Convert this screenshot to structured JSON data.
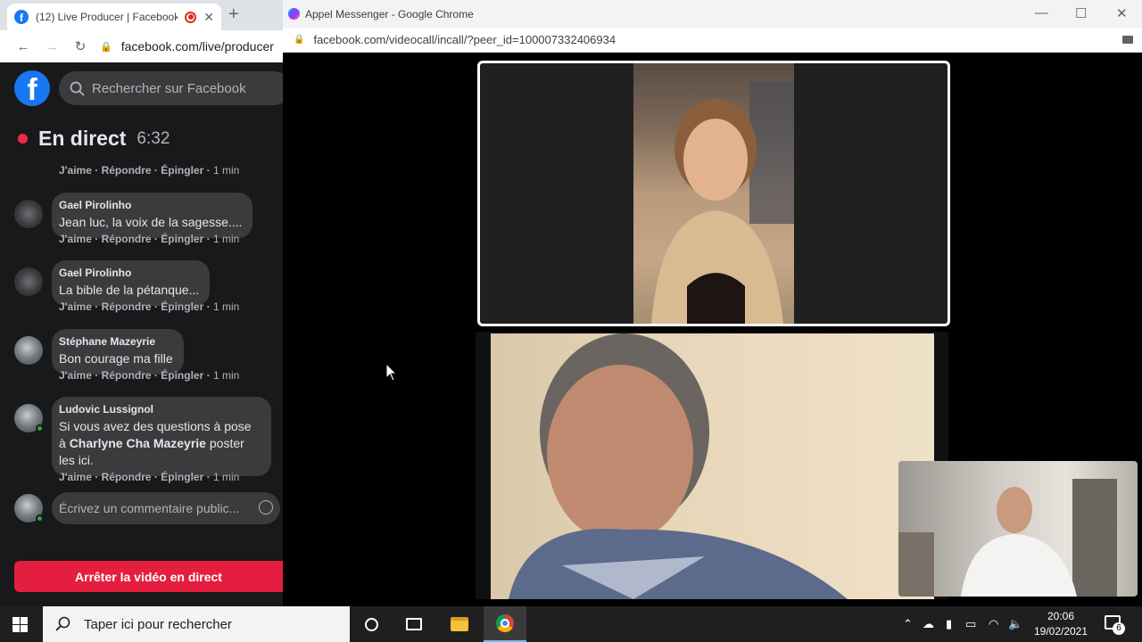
{
  "left_window": {
    "tab_title": "(12) Live Producer | Facebook",
    "url": "facebook.com/live/producer",
    "search_placeholder": "Rechercher sur Facebook",
    "live_label": "En direct",
    "live_time": "6:32",
    "action_like": "J'aime",
    "action_reply": "Répondre",
    "action_pin": "Épingler",
    "comments": [
      {
        "author": "",
        "text": "",
        "time": "1 min"
      },
      {
        "author": "Gael Pirolinho",
        "text": "Jean luc, la voix de la sagesse....",
        "time": "1 min"
      },
      {
        "author": "Gael Pirolinho",
        "text": "La bible de la pétanque...",
        "time": "1 min"
      },
      {
        "author": "Stéphane Mazeyrie",
        "text": "Bon courage ma fille",
        "time": "1 min"
      },
      {
        "author": "Ludovic Lussignol",
        "text_before": "Si vous avez des questions à pose à ",
        "mention": "Charlyne Cha Mazeyrie",
        "text_after": " poster les ici.",
        "time": "1 min"
      }
    ],
    "comment_placeholder": "Écrivez un commentaire public...",
    "stop_button": "Arrêter la vidéo en direct"
  },
  "right_window": {
    "title": "Appel Messenger - Google Chrome",
    "url": "facebook.com/videocall/incall/?peer_id=100007332406934"
  },
  "taskbar": {
    "search_placeholder": "Taper ici pour rechercher",
    "time": "20:06",
    "date": "19/02/2021",
    "notification_count": "6"
  },
  "colors": {
    "facebook_blue": "#1877f2",
    "live_red": "#f02849",
    "stop_button": "#e41e3f"
  }
}
